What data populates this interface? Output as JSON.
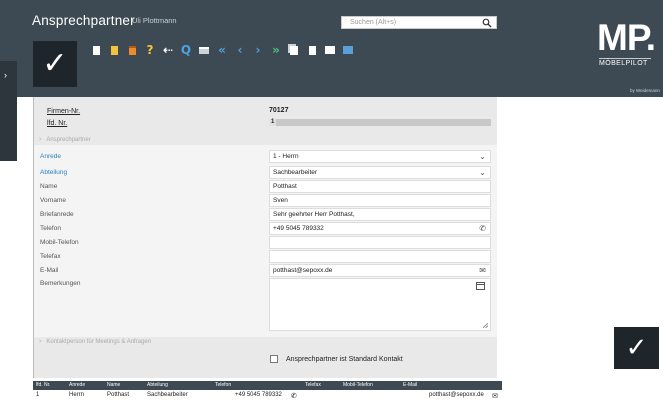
{
  "header": {
    "title": "Ansprechpartner",
    "user": "Uli Plottmann",
    "search_placeholder": "Suchen (Alt+s)"
  },
  "logo": {
    "mark": "MP.",
    "sub": "MÖBELPILOT",
    "small": "by Weidemann"
  },
  "toolbar": {
    "icons": [
      "new-doc-icon",
      "copy-doc-icon",
      "delete-icon",
      "help-icon",
      "back-icon",
      "search-icon",
      "print-icon",
      "first-icon",
      "prev-icon",
      "next-icon",
      "last-icon",
      "documents-icon",
      "attachments-icon",
      "book-icon",
      "tag-icon"
    ],
    "glyphs": {
      "help": "?",
      "back": "⇠",
      "search": "Q",
      "first": "«",
      "prev": "‹",
      "next": "›",
      "last": "»"
    }
  },
  "record": {
    "firmen_nr_label": "Firmen-Nr.",
    "firmen_nr_value": "70127",
    "lfd_nr_label": "lfd. Nr.",
    "lfd_nr_value": "1",
    "progress": 0.03
  },
  "sections": {
    "ansprechpartner": "Ansprechpartner",
    "kontaktpersonen": "Kontaktperson für Meetings & Anfragen"
  },
  "form": {
    "anrede_label": "Anrede",
    "anrede_value": "1 - Herrn",
    "abteilung_label": "Abteilung",
    "abteilung_value": "Sachbearbeiter",
    "name_label": "Name",
    "name_value": "Potthast",
    "vorname_label": "Vorname",
    "vorname_value": "Sven",
    "briefanrede_label": "Briefanrede",
    "briefanrede_value": "Sehr geehrter Herr Potthast,",
    "telefon_label": "Telefon",
    "telefon_value": "+49 5045 789332",
    "mobil_label": "Mobil-Telefon",
    "mobil_value": "",
    "telefax_label": "Telefax",
    "telefax_value": "",
    "email_label": "E-Mail",
    "email_value": "potthast@sepoxx.de",
    "bemerkungen_label": "Bemerkungen",
    "standard_kontakt_label": "Ansprechpartner ist Standard Kontakt"
  },
  "table": {
    "columns": [
      "lfd. Nr.",
      "Anrede",
      "Name",
      "Abteilung",
      "Telefon",
      "Telefax",
      "Mobil-Telefon",
      "E-Mail"
    ],
    "rows": [
      {
        "nr": "1",
        "anrede": "Herrn",
        "name": "Potthast",
        "abteilung": "Sachbearbeiter",
        "telefon": "+49 5045 789332",
        "email": "potthast@sepoxx.de"
      }
    ]
  },
  "colors": {
    "header_bg": "#3e4a53",
    "accent_link": "#2a7fbd",
    "button_dark": "#1f262b"
  }
}
